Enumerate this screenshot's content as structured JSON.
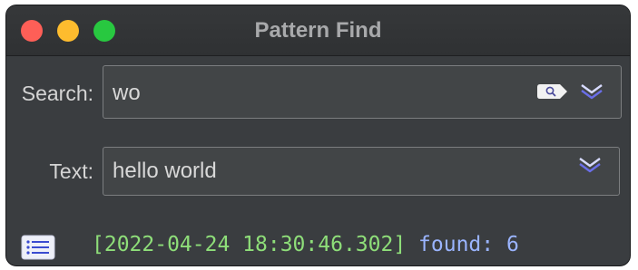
{
  "window": {
    "title": "Pattern Find",
    "traffic_lights": {
      "close_color": "#fe5f57",
      "minimize_color": "#febc2e",
      "maximize_color": "#28c840"
    }
  },
  "search": {
    "label": "Search:",
    "value": "wo",
    "search_icon": "magnifier-pill-icon",
    "dropdown_icon": "chevron-down-icon"
  },
  "text": {
    "label": "Text:",
    "value": "hello world",
    "dropdown_icon": "chevron-down-icon"
  },
  "status": {
    "list_icon": "list-icon",
    "timestamp": "[2022-04-24 18:30:46.302]",
    "found": "found: 6",
    "timestamp_color": "#8ede79",
    "found_color": "#9ab4ff"
  }
}
